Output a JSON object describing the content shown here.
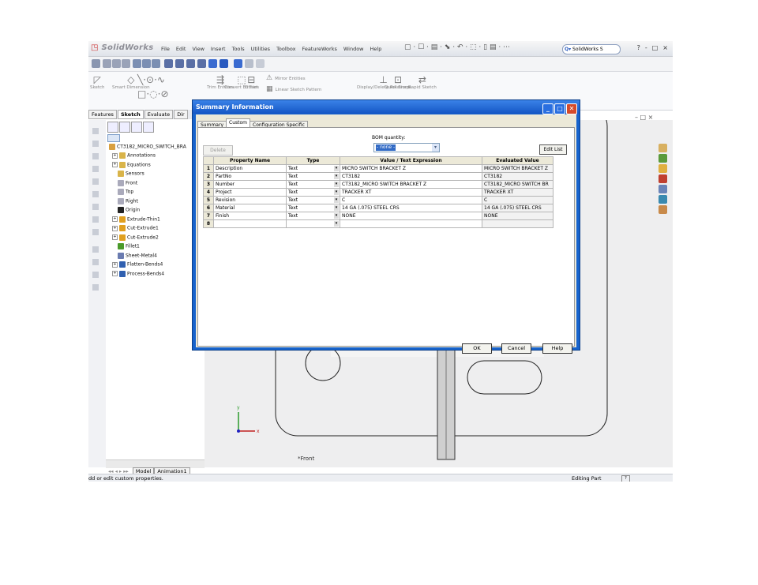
{
  "app": {
    "logo": "SolidWorks",
    "menu": [
      "File",
      "Edit",
      "View",
      "Insert",
      "Tools",
      "Utilities",
      "Toolbox",
      "FeatureWorks",
      "Window",
      "Help"
    ],
    "search_placeholder": "SolidWorks S",
    "window_controls": [
      "?",
      "-",
      "□",
      "×"
    ]
  },
  "ribbon": [
    {
      "glyph": "◸",
      "label": "Sketch"
    },
    {
      "glyph": "◇",
      "label": "Smart Dimension"
    },
    {
      "glyph": "╲·⊙·∿",
      "label": ""
    },
    {
      "glyph": "□·◌·⊘",
      "label": ""
    },
    {
      "glyph": "⇶",
      "label": "Trim Entities"
    },
    {
      "glyph": "⬚",
      "label": "Convert Entities"
    },
    {
      "glyph": "⊟",
      "label": "Offset"
    },
    {
      "glyph": "⚠",
      "label": "Mirror Entities"
    },
    {
      "glyph": "▦",
      "label": "Linear Sketch Pattern"
    },
    {
      "glyph": "⊥",
      "label": "Display/Delete Relations"
    },
    {
      "glyph": "⊡",
      "label": "Quick Snaps"
    },
    {
      "glyph": "⇄",
      "label": "Rapid Sketch"
    }
  ],
  "left_tabs": [
    "Features",
    "Sketch",
    "Evaluate",
    "Dir"
  ],
  "tree": {
    "root": "CT3182_MICRO_SWITCH_BRA",
    "items": [
      {
        "label": "Annotations",
        "expand": "+",
        "color": "#d9b44a"
      },
      {
        "label": "Equations",
        "expand": "+",
        "color": "#d9b44a"
      },
      {
        "label": "Sensors",
        "expand": "",
        "color": "#d9b44a"
      },
      {
        "label": "Front",
        "expand": "",
        "color": "#aab"
      },
      {
        "label": "Top",
        "expand": "",
        "color": "#aab"
      },
      {
        "label": "Right",
        "expand": "",
        "color": "#aab"
      },
      {
        "label": "Origin",
        "expand": "",
        "color": "#222"
      },
      {
        "label": "Extrude-Thin1",
        "expand": "+",
        "color": "#e0a020"
      },
      {
        "label": "Cut-Extrude1",
        "expand": "+",
        "color": "#e0a020"
      },
      {
        "label": "Cut-Extrude2",
        "expand": "+",
        "color": "#e0a020"
      },
      {
        "label": "Fillet1",
        "expand": "",
        "color": "#4a9a2a"
      },
      {
        "label": "Sheet-Metal4",
        "expand": "",
        "color": "#6a7bb0"
      },
      {
        "label": "Flatten-Bends4",
        "expand": "+",
        "color": "#3060b0"
      },
      {
        "label": "Process-Bends4",
        "expand": "+",
        "color": "#3060b0"
      }
    ]
  },
  "model_tabs": [
    "Model",
    "Animation1"
  ],
  "status": {
    "left": "dd or edit custom properties.",
    "right": "Editing Part"
  },
  "viewport": {
    "view_label": "*Front",
    "controls": "– □ ×"
  },
  "dialog": {
    "title": "Summary Information",
    "tabs": [
      "Summary",
      "Custom",
      "Configuration Specific"
    ],
    "active_tab": "Custom",
    "delete_label": "Delete",
    "bom_label": "BOM quantity:",
    "bom_value": "- none -",
    "edit_list_label": "Edit List",
    "columns": [
      "Property Name",
      "Type",
      "Value / Text Expression",
      "Evaluated Value"
    ],
    "rows": [
      {
        "n": "1",
        "name": "Description",
        "type": "Text",
        "value": "MICRO SWITCH BRACKET Z",
        "evaluated": "MICRO SWITCH BRACKET Z"
      },
      {
        "n": "2",
        "name": "PartNo",
        "type": "Text",
        "value": "CT3182",
        "evaluated": "CT3182"
      },
      {
        "n": "3",
        "name": "Number",
        "type": "Text",
        "value": "CT3182_MICRO SWITCH BRACKET Z",
        "evaluated": "CT3182_MICRO SWITCH BR"
      },
      {
        "n": "4",
        "name": "Project",
        "type": "Text",
        "value": "TRACKER XT",
        "evaluated": "TRACKER XT"
      },
      {
        "n": "5",
        "name": "Revision",
        "type": "Text",
        "value": "C",
        "evaluated": "C"
      },
      {
        "n": "6",
        "name": "Material",
        "type": "Text",
        "value": "14 GA (.075) STEEL CRS",
        "evaluated": "14 GA (.075) STEEL CRS"
      },
      {
        "n": "7",
        "name": "Finish",
        "type": "Text",
        "value": "NONE",
        "evaluated": "NONE"
      },
      {
        "n": "8",
        "name": "",
        "type": "",
        "value": "",
        "evaluated": ""
      }
    ],
    "ok_label": "OK",
    "cancel_label": "Cancel",
    "help_label": "Help"
  }
}
